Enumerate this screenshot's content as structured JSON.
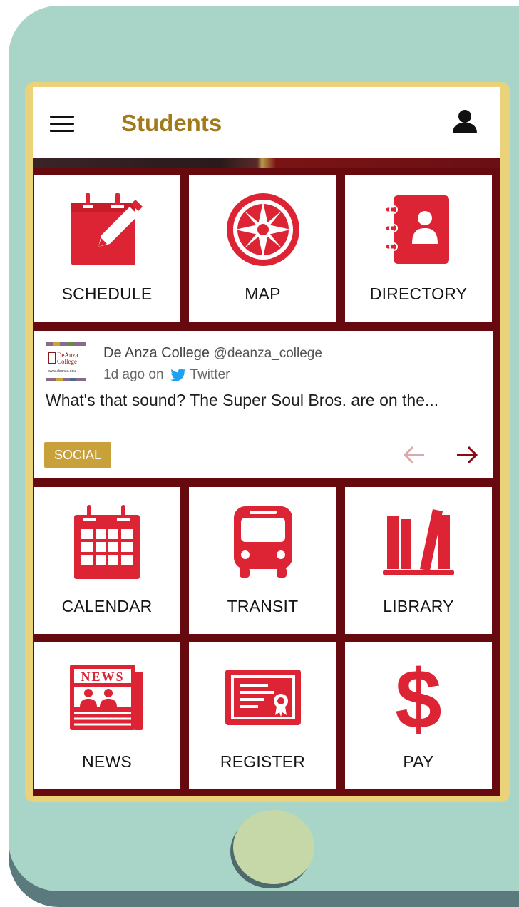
{
  "app": {
    "title": "Students"
  },
  "tiles_top": [
    {
      "label": "SCHEDULE",
      "icon": "calendar-edit-icon"
    },
    {
      "label": "MAP",
      "icon": "compass-icon"
    },
    {
      "label": "DIRECTORY",
      "icon": "contact-book-icon"
    }
  ],
  "social_card": {
    "author": "De Anza College",
    "handle": "@deanza_college",
    "time": "1d ago on",
    "platform": "Twitter",
    "text": "What's that sound? The Super Soul Bros. are on the...",
    "badge": "SOCIAL",
    "logo_text_line1": "DeAnza",
    "logo_text_line2": "College",
    "logo_url_text": "www.deanza.edu"
  },
  "tiles_mid": [
    {
      "label": "CALENDAR",
      "icon": "calendar-grid-icon"
    },
    {
      "label": "TRANSIT",
      "icon": "bus-icon"
    },
    {
      "label": "LIBRARY",
      "icon": "books-icon"
    }
  ],
  "tiles_bottom": [
    {
      "label": "NEWS",
      "icon": "newspaper-icon"
    },
    {
      "label": "REGISTER",
      "icon": "certificate-icon"
    },
    {
      "label": "PAY",
      "icon": "dollar-icon"
    }
  ],
  "colors": {
    "accent_red": "#dc2434",
    "maroon": "#660a10",
    "title_gold": "#a17a1c",
    "badge_gold": "#c9a13a",
    "twitter_blue": "#1da1f2",
    "phone_teal": "#a8d5c8",
    "bezel_yellow": "#e9d27a"
  }
}
